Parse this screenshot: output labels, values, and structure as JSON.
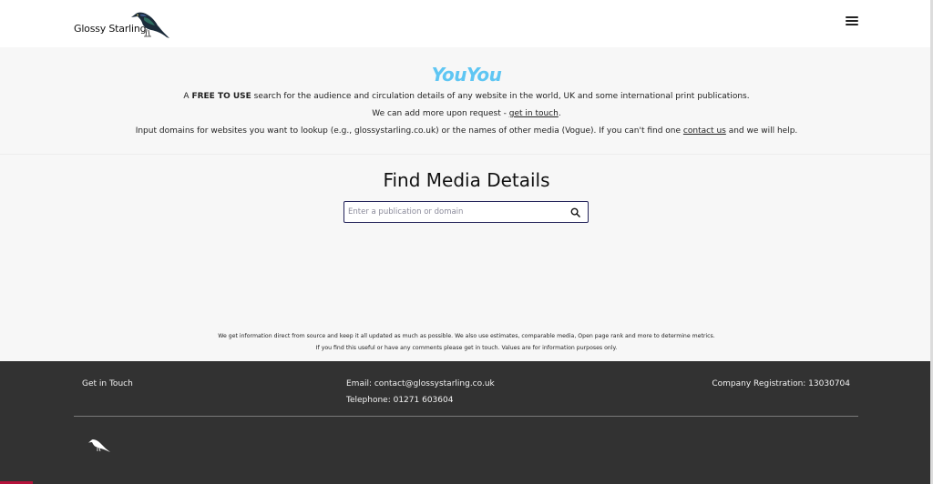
{
  "header": {
    "brand_name": "Glossy Starling",
    "logo_icon": "starling-bird-icon",
    "menu_icon": "hamburger-menu-icon"
  },
  "hero": {
    "logo_text": "YouYou",
    "logo_color": "#5fc6f3",
    "line1_pre": "A ",
    "line1_bold": "FREE TO USE",
    "line1_post": " search for the audience and circulation details of any website in the world, UK and some international print publications.",
    "line2_pre": "We can add more upon request - ",
    "line2_link": "get in touch",
    "line2_post": ".",
    "line3_pre": "Input domains for websites you want to lookup (e.g., glossystarling.co.uk) or the names of other media (Vogue). If you can't find one ",
    "line3_link": "contact us",
    "line3_post": " and we will help."
  },
  "search": {
    "title": "Find Media Details",
    "placeholder": "Enter a publication or domain",
    "value": "",
    "icon": "search-icon"
  },
  "disclaimer": {
    "line1": "We get information direct from source and keep it all updated as much as possible. We also use estimates, comparable media, Open page rank and more to determine metrics.",
    "line2": "If you find this useful or have any comments please get in touch. Values are for information purposes only."
  },
  "footer": {
    "get_in_touch": "Get in Touch",
    "email": "Email: contact@glossystarling.co.uk",
    "telephone": "Telephone: 01271 603604",
    "registration": "Company Registration: 13030704",
    "logo_icon": "starling-bird-icon",
    "background_color": "#323232",
    "accent_color": "#b5123a"
  }
}
